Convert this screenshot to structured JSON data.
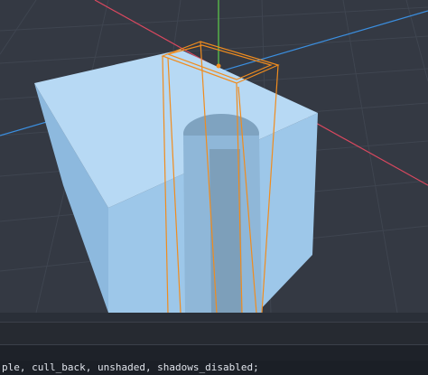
{
  "viewport": {
    "colors": {
      "background": "#343943",
      "grid": "#3f4550",
      "x_axis": "#d9485f",
      "y_axis": "#58b849",
      "z_axis": "#3b8fe0",
      "cube_top": "#b7d9f4",
      "cube_front": "#9dc7e9",
      "cube_side": "#8db9de",
      "hole_floor": "#7fa3c0",
      "gizmo": "#f08c1e"
    },
    "icons": [
      "grid-floor",
      "axis-gizmo",
      "selection-box"
    ]
  },
  "bottom_panel": {
    "code_text": "ple, cull_back, unshaded, shadows_disabled;"
  }
}
